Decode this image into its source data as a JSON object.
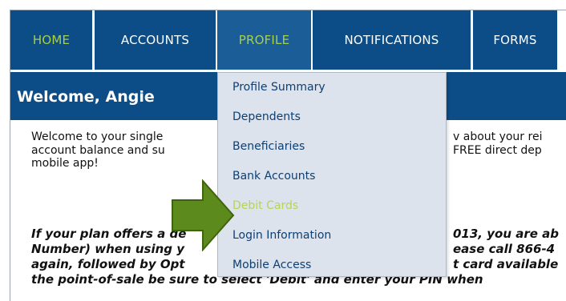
{
  "nav": {
    "tabs": [
      {
        "label": "HOME"
      },
      {
        "label": "ACCOUNTS"
      },
      {
        "label": "PROFILE"
      },
      {
        "label": "NOTIFICATIONS"
      },
      {
        "label": "FORMS"
      }
    ],
    "active_tab": "HOME",
    "hover_tab": "PROFILE"
  },
  "welcome": {
    "title": "Welcome, Angie"
  },
  "content": {
    "para1_lines": [
      "Welcome to your single",
      "account balance and su",
      "mobile app!"
    ],
    "para1_right_lines": [
      "v about your rei",
      "FREE direct dep"
    ],
    "para2_lines": [
      "If your plan offers a de",
      "Number) when using y",
      "again, followed by Opt",
      "the point-of-sale be sure to select 'Debit' and enter your PIN when"
    ],
    "para2_right_lines": [
      "013, you are ab",
      "ease call 866-4",
      "t card available"
    ]
  },
  "dropdown": {
    "items": [
      {
        "label": "Profile Summary"
      },
      {
        "label": "Dependents"
      },
      {
        "label": "Beneficiaries"
      },
      {
        "label": "Bank Accounts"
      },
      {
        "label": "Debit Cards"
      },
      {
        "label": "Login Information"
      },
      {
        "label": "Mobile Access"
      }
    ],
    "highlighted": "Debit Cards"
  },
  "colors": {
    "nav_bg": "#0d4d87",
    "accent_green": "#a9cf45",
    "dropdown_bg": "#dde3ec",
    "arrow_fill": "#5d8a1c"
  }
}
